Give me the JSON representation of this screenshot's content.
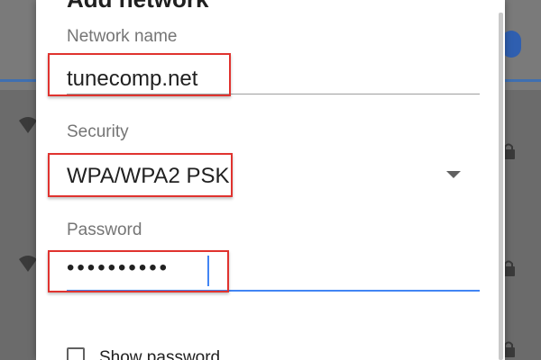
{
  "dialog": {
    "title": "Add network",
    "network_name": {
      "label": "Network name",
      "value": "tunecomp.net"
    },
    "security": {
      "label": "Security",
      "selected": "WPA/WPA2 PSK"
    },
    "password": {
      "label": "Password",
      "value": "••••••••••"
    },
    "show_password": {
      "label": "Show password",
      "checked": false
    }
  },
  "colors": {
    "accent": "#4285f4",
    "highlight": "#e0332f"
  },
  "icons": [
    "wifi-icon",
    "lock-icon",
    "dropdown-arrow-icon",
    "checkbox-icon"
  ]
}
